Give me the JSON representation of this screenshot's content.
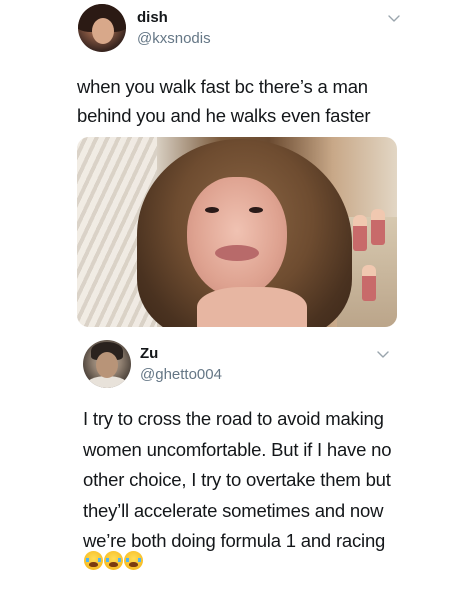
{
  "tweets": [
    {
      "author": {
        "name": "dish",
        "handle": "@kxsnodis"
      },
      "text_lines": [
        "when you walk fast bc there’s a man",
        "behind you and he walks even faster"
      ],
      "has_photo": true,
      "menu_icon": "chevron-down-icon"
    },
    {
      "author": {
        "name": "Zu",
        "handle": "@ghetto004"
      },
      "text_lines": [
        "I try to cross the road to avoid making",
        "women uncomfortable. But if I have no",
        "other choice, I try to overtake them but",
        "they’ll accelerate sometimes and now",
        "we’re both doing formula 1 and racing"
      ],
      "emojis": [
        "loudly-crying-face",
        "loudly-crying-face",
        "loudly-crying-face"
      ],
      "menu_icon": "chevron-down-icon"
    }
  ],
  "colors": {
    "name": "#14171a",
    "handle": "#657786",
    "chevron": "#9aa5ad"
  }
}
